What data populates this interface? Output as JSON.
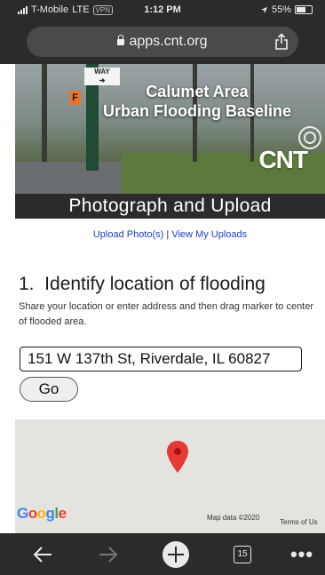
{
  "status_bar": {
    "carrier": "T-Mobile",
    "network": "LTE",
    "vpn": "VPN",
    "time": "1:12 PM",
    "battery": "55%",
    "battery_level": 0.55
  },
  "browser": {
    "url": "apps.cnt.org",
    "tab_count": "15"
  },
  "hero": {
    "title_line1": "Calumet Area",
    "title_line2": "Urban Flooding Baseline",
    "sign_text": "WAY",
    "f_label": "F",
    "logo": "CNT"
  },
  "section_title": "Photograph and Upload",
  "links": {
    "upload": "Upload Photo(s)",
    "separator": "|",
    "view": "View My Uploads"
  },
  "step": {
    "title": "1.  Identify location of flooding",
    "description": "Share your location or enter address and then drag marker to center of flooded area."
  },
  "address_input": {
    "value": "151 W 137th St, Riverdale, IL 60827"
  },
  "go_button": "Go",
  "map": {
    "attribution": "Map data ©2020",
    "terms": "Terms of Us",
    "google_letters": [
      {
        "ch": "G",
        "color": "#4285F4"
      },
      {
        "ch": "o",
        "color": "#EA4335"
      },
      {
        "ch": "o",
        "color": "#FBBC05"
      },
      {
        "ch": "g",
        "color": "#4285F4"
      },
      {
        "ch": "l",
        "color": "#34A853"
      },
      {
        "ch": "e",
        "color": "#EA4335"
      }
    ],
    "marker_color": "#e53935"
  }
}
